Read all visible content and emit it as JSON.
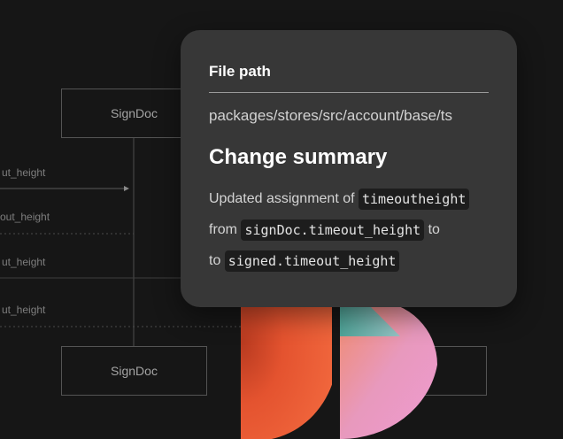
{
  "diagram": {
    "nodes": [
      "SignDoc",
      "SignDoc"
    ],
    "edge_labels": [
      "ut_height",
      "out_height",
      "ut_height",
      "ut_height"
    ]
  },
  "popover": {
    "file_path_label": "File path",
    "file_path": "packages/stores/src/account/base/ts",
    "heading": "Change summary",
    "line1_prefix": "Updated assignment of",
    "line1_code": "timeoutheight",
    "line2_prefix": "from",
    "line2_code": "signDoc.timeout_height",
    "line2_suffix": "to",
    "line3_prefix": "to",
    "line3_code": "signed.timeout_height"
  },
  "colors": {
    "background": "#161616",
    "popover": "#373737",
    "code_bg": "#1d1d1d",
    "accent_orange": "#e5532e",
    "accent_pink": "#e995c4",
    "accent_teal": "#48b3a8"
  }
}
